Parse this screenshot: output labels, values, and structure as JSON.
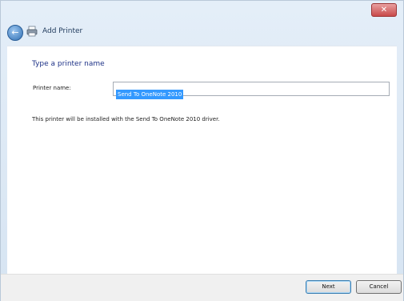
{
  "titlebar": {
    "close_glyph": "✕"
  },
  "nav": {
    "back_glyph": "←",
    "title": "Add Printer",
    "icon": "printer-icon"
  },
  "content": {
    "heading": "Type a printer name",
    "printer_name_label": "Printer name:",
    "printer_name_value": "Send To OneNote 2010",
    "info": "This printer will be installed with the Send To OneNote 2010 driver."
  },
  "footer": {
    "next_label": "Next",
    "cancel_label": "Cancel"
  },
  "colors": {
    "heading": "#1e3287",
    "selection": "#3399ff",
    "close": "#c94a4a"
  }
}
